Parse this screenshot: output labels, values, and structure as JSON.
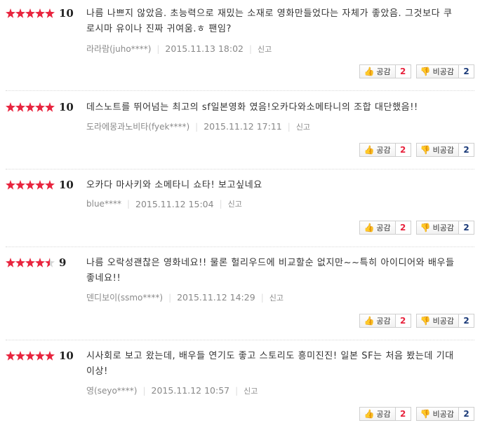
{
  "labels": {
    "like": "공감",
    "dislike": "비공감",
    "report": "신고"
  },
  "colors": {
    "star": "#e8243e",
    "like_count": "#e8243e",
    "dislike_count": "#1d3c7a"
  },
  "reviews": [
    {
      "rating": 10,
      "stars": 5,
      "text": "나름 나쁘지 않았음. 초능력으로 재밌는 소재로 영화만들었다는 자체가 좋았음. 그것보다 쿠로시마 유이나 진짜 귀여움.ㅎ 팬임?",
      "author": "라라람(juho****)",
      "date": "2015.11.13 18:02",
      "likes": "2",
      "dislikes": "2"
    },
    {
      "rating": 10,
      "stars": 5,
      "text": "데스노트를 뛰어넘는 최고의 sf일본영화 였음!오카다와소메타니의 조합 대단했음!!",
      "author": "도라에몽과노비타(fyek****)",
      "date": "2015.11.12 17:11",
      "likes": "2",
      "dislikes": "2"
    },
    {
      "rating": 10,
      "stars": 5,
      "text": "오카다 마사키와 소메타니 쇼타! 보고싶네요",
      "author": "blue****",
      "date": "2015.11.12 15:04",
      "likes": "2",
      "dislikes": "2"
    },
    {
      "rating": 9,
      "stars": 4.5,
      "text": "나름 오락성괜찮은 영화네요!! 물론 헐리우드에 비교할순 없지만~~특히 아이디어와 배우들 좋네요!!",
      "author": "덴디보이(ssmo****)",
      "date": "2015.11.12 14:29",
      "likes": "2",
      "dislikes": "2"
    },
    {
      "rating": 10,
      "stars": 5,
      "text": "시사회로 보고 왔는데, 배우들 연기도 좋고 스토리도 흥미진진! 일본 SF는 처음 봤는데 기대 이상!",
      "author": "영(seyo****)",
      "date": "2015.11.12 10:57",
      "likes": "2",
      "dislikes": "2"
    }
  ]
}
